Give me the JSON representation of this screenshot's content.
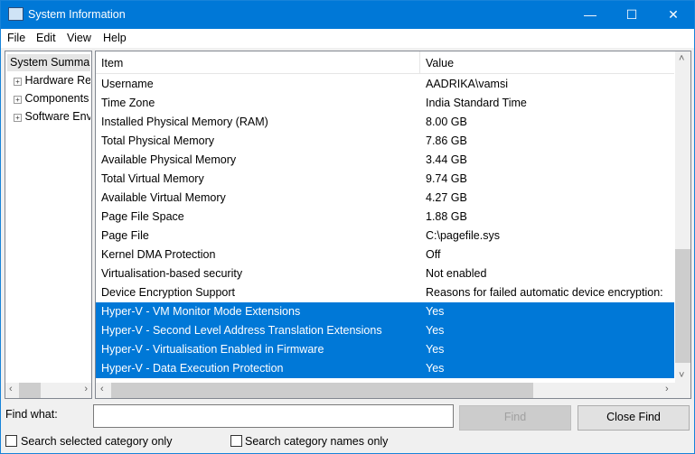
{
  "window": {
    "title": "System Information",
    "minimize": "—",
    "maximize": "☐",
    "close": "✕"
  },
  "menu": [
    "File",
    "Edit",
    "View",
    "Help"
  ],
  "tree": {
    "root": "System Summary",
    "children": [
      "Hardware Resources",
      "Components",
      "Software Environment"
    ],
    "expander": "+"
  },
  "table": {
    "headers": [
      "Item",
      "Value"
    ],
    "rows": [
      [
        "Username",
        "AADRIKA\\vamsi"
      ],
      [
        "Time Zone",
        "India Standard Time"
      ],
      [
        "Installed Physical Memory (RAM)",
        "8.00 GB"
      ],
      [
        "Total Physical Memory",
        "7.86 GB"
      ],
      [
        "Available Physical Memory",
        "3.44 GB"
      ],
      [
        "Total Virtual Memory",
        "9.74 GB"
      ],
      [
        "Available Virtual Memory",
        "4.27 GB"
      ],
      [
        "Page File Space",
        "1.88 GB"
      ],
      [
        "Page File",
        "C:\\pagefile.sys"
      ],
      [
        "Kernel DMA Protection",
        "Off"
      ],
      [
        "Virtualisation-based security",
        "Not enabled"
      ],
      [
        "Device Encryption Support",
        "Reasons for failed automatic device encryption: "
      ],
      [
        "Hyper-V - VM Monitor Mode Extensions",
        "Yes"
      ],
      [
        "Hyper-V - Second Level Address Translation Extensions",
        "Yes"
      ],
      [
        "Hyper-V - Virtualisation Enabled in Firmware",
        "Yes"
      ],
      [
        "Hyper-V - Data Execution Protection",
        "Yes"
      ]
    ],
    "selected_rows": [
      12,
      13,
      14,
      15
    ]
  },
  "scroll": {
    "up": "˄",
    "down": "˅",
    "left": "‹",
    "right": "›"
  },
  "find": {
    "label": "Find what:",
    "value": "",
    "find_button": "Find",
    "close_button": "Close Find",
    "chk1": "Search selected category only",
    "chk2": "Search category names only"
  }
}
